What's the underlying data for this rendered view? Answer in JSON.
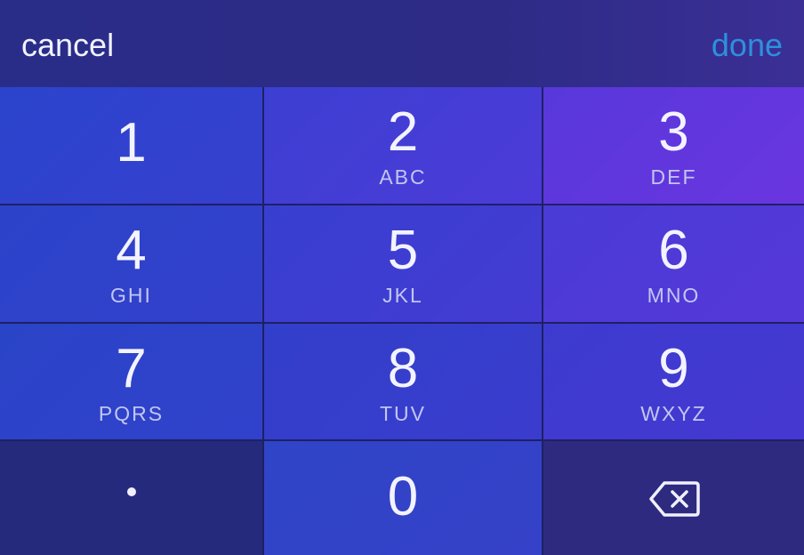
{
  "topbar": {
    "cancel_label": "cancel",
    "done_label": "done"
  },
  "keypad": {
    "keys": [
      {
        "digit": "1",
        "letters": ""
      },
      {
        "digit": "2",
        "letters": "ABC"
      },
      {
        "digit": "3",
        "letters": "DEF"
      },
      {
        "digit": "4",
        "letters": "GHI"
      },
      {
        "digit": "5",
        "letters": "JKL"
      },
      {
        "digit": "6",
        "letters": "MNO"
      },
      {
        "digit": "7",
        "letters": "PQRS"
      },
      {
        "digit": "8",
        "letters": "TUV"
      },
      {
        "digit": "9",
        "letters": "WXYZ"
      },
      {
        "digit": "0",
        "letters": ""
      }
    ],
    "decimal_key_icon": "dot-icon",
    "delete_key_icon": "backspace-icon"
  },
  "colors": {
    "done": "#2d90dd",
    "text": "#f3f3ff",
    "letters": "#c2c6f2"
  }
}
